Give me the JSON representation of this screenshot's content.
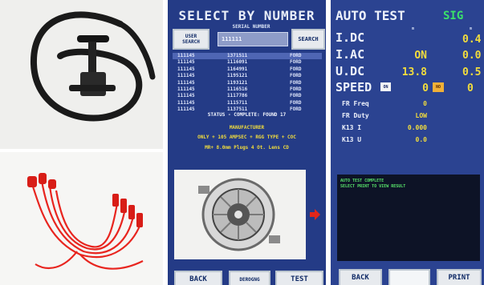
{
  "select_screen": {
    "title": "SELECT BY NUMBER",
    "serial_label": "SERIAL NUMBER",
    "search_value": "111111",
    "user_search_label_1": "USER",
    "user_search_label_2": "SEARCH",
    "search_button": "SEARCH",
    "results": [
      [
        "111145",
        "1371511",
        "FORD"
      ],
      [
        "111145",
        "1116091",
        "FORD"
      ],
      [
        "111145",
        "1164991",
        "FORD"
      ],
      [
        "111145",
        "1195121",
        "FORD"
      ],
      [
        "111145",
        "1193121",
        "FORD"
      ],
      [
        "111145",
        "1116516",
        "FORD"
      ],
      [
        "111145",
        "1117786",
        "FORD"
      ],
      [
        "111145",
        "1115711",
        "FORD"
      ],
      [
        "111145",
        "1137511",
        "FORD"
      ]
    ],
    "selected_row": 0,
    "status": "STATUS - COMPLETE: FOUND 17",
    "manufacturer_title": "MANUFACTURER",
    "manufacturer_line1": "ONLY + 105 AMPSEC +  RGG TYPE + COC",
    "manufacturer_line2": "MR+  8.0mm Plugs   4 Ot. Lens CD",
    "back_button": "BACK",
    "other_button": "DEROGNG",
    "test_button": "TEST",
    "accent_color": "#243b86",
    "highlight_color": "#f2dd3d",
    "icons": [
      "arrow-right-icon"
    ]
  },
  "auto_test_screen": {
    "title": "AUTO TEST",
    "sig_label": "SIG",
    "unit_left": "m",
    "unit_right": "m",
    "measurements": [
      {
        "label": "I.DC",
        "value": "",
        "sig": "0.4"
      },
      {
        "label": "I.AC",
        "value": "ON",
        "sig": "0.0"
      },
      {
        "label": "U.DC",
        "value": "13.8",
        "sig": "0.5"
      },
      {
        "label": "SPEED",
        "value": "0",
        "sig": "0"
      }
    ],
    "speed_box_left": "ON",
    "speed_box_right": "NO",
    "sub_measurements": [
      {
        "label": "FR Freq",
        "value": "0"
      },
      {
        "label": "FR Duty",
        "value": "LOW"
      },
      {
        "label": "K13 I",
        "value": "0.000"
      },
      {
        "label": "K13 U",
        "value": "0.0"
      }
    ],
    "console_line1": "AUTO TEST COMPLETE",
    "console_line2": "SELECT PRINT TO VIEW RESULT",
    "back_button": "BACK",
    "print_button": "PRINT",
    "value_color": "#f2dd3d",
    "sig_color": "#3be06a"
  }
}
